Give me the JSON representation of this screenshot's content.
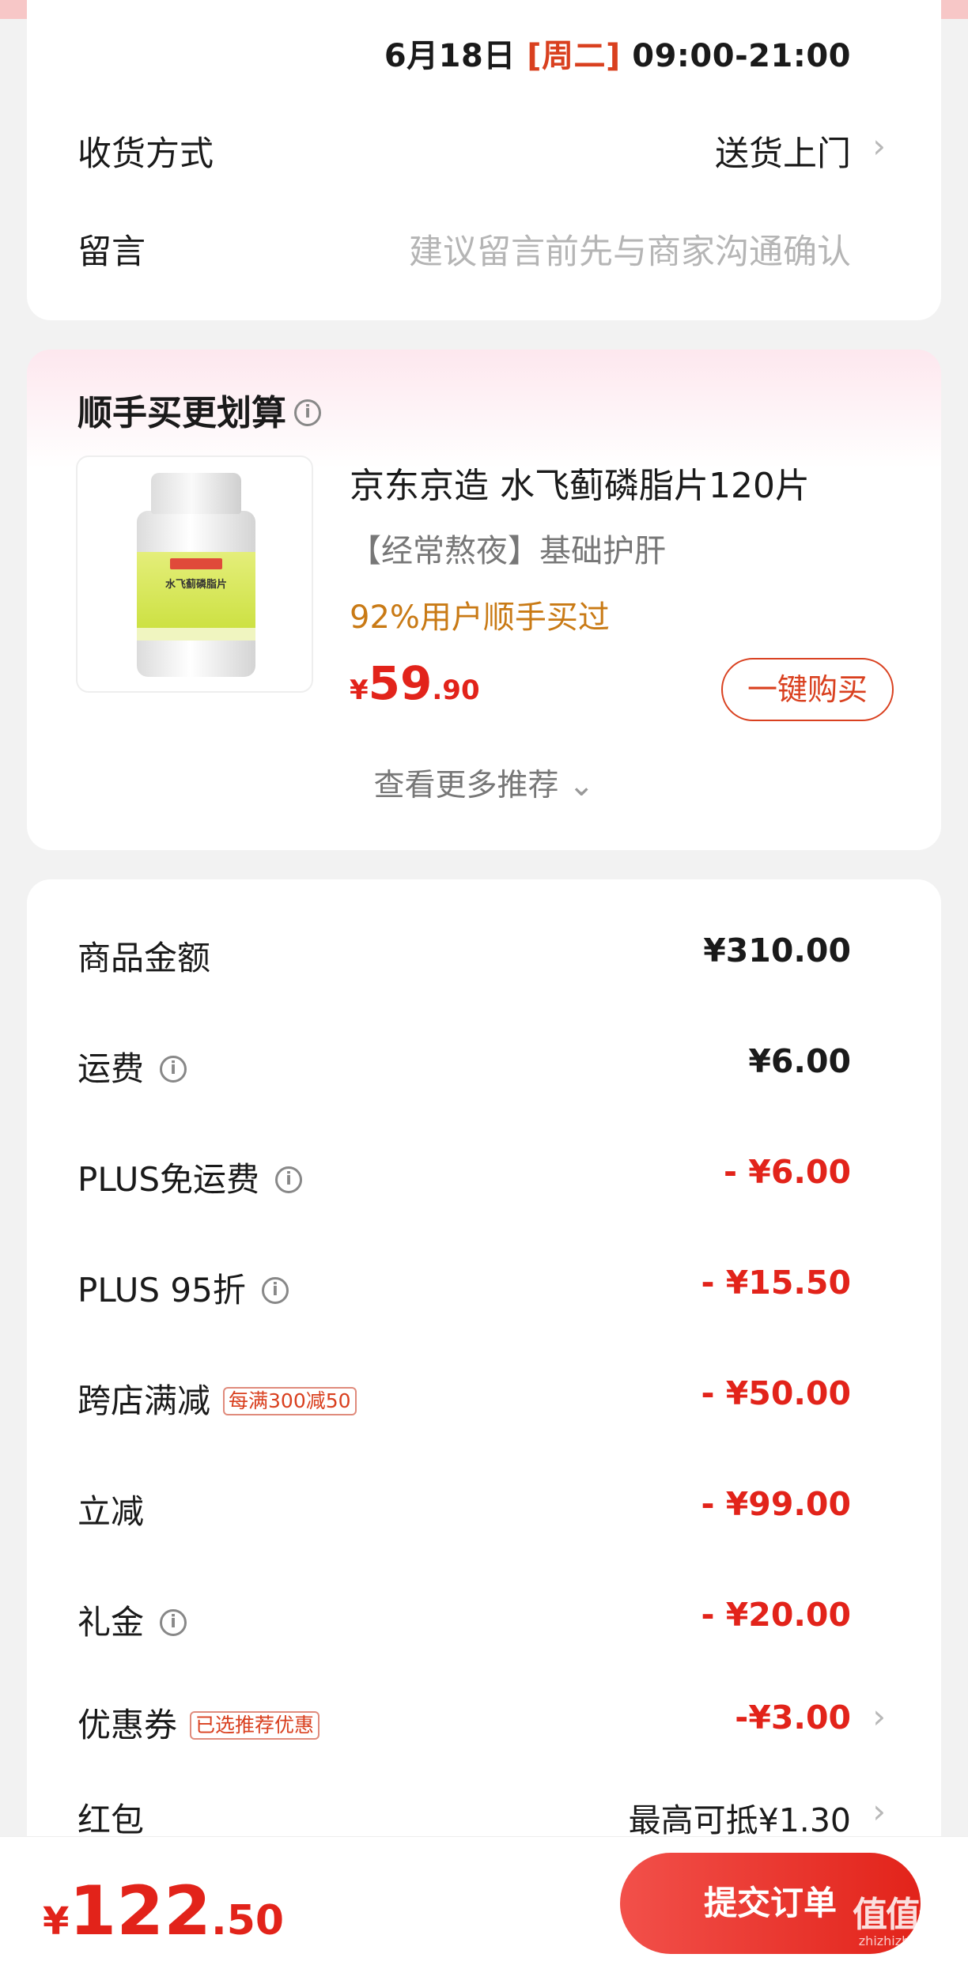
{
  "delivery": {
    "date": "6月18日",
    "weekday": "[周二]",
    "time_range": "09:00-21:00",
    "method_label": "收货方式",
    "method_value": "送货上门",
    "message_label": "留言",
    "message_placeholder": "建议留言前先与商家沟通确认"
  },
  "upsell": {
    "title": "顺手买更划算",
    "product_name": "京东京造 水飞蓟磷脂片120片",
    "product_tag": "【经常熬夜】基础护肝",
    "bought_ratio": "92%用户顺手买过",
    "price_currency": "¥",
    "price_int": "59",
    "price_dec": ".90",
    "buy_button": "一键购买",
    "more_link": "查看更多推荐",
    "image_label": "水飞蓟磷脂片"
  },
  "fees": [
    {
      "label": "商品金额",
      "amount": "¥310.00",
      "info": false,
      "badge": "",
      "red": false,
      "chevron": false
    },
    {
      "label": "运费",
      "amount": "¥6.00",
      "info": true,
      "badge": "",
      "red": false,
      "chevron": false
    },
    {
      "label": "PLUS免运费",
      "amount": "- ¥6.00",
      "info": true,
      "badge": "",
      "red": true,
      "chevron": false
    },
    {
      "label": "PLUS 95折",
      "amount": "- ¥15.50",
      "info": true,
      "badge": "",
      "red": true,
      "chevron": false
    },
    {
      "label": "跨店满减",
      "amount": "- ¥50.00",
      "info": false,
      "badge": "每满300减50",
      "red": true,
      "chevron": false
    },
    {
      "label": "立减",
      "amount": "- ¥99.00",
      "info": false,
      "badge": "",
      "red": true,
      "chevron": false
    },
    {
      "label": "礼金",
      "amount": "- ¥20.00",
      "info": true,
      "badge": "",
      "red": true,
      "chevron": false
    },
    {
      "label": "优惠券",
      "amount": "-¥3.00",
      "info": false,
      "badge": "已选推荐优惠",
      "red": true,
      "chevron": true
    },
    {
      "label": "红包",
      "amount": "最高可抵¥1.30",
      "info": false,
      "badge": "",
      "red": false,
      "chevron": true
    }
  ],
  "footer": {
    "currency": "¥",
    "total_int": "122",
    "total_dec": ".50",
    "submit_button": "提交订单",
    "watermark": "值值值",
    "watermark_sub": "zhizhizhi.com"
  },
  "colors": {
    "accent": "#e2231a",
    "orange_text": "#c97a15",
    "background": "#f2f2f2"
  }
}
